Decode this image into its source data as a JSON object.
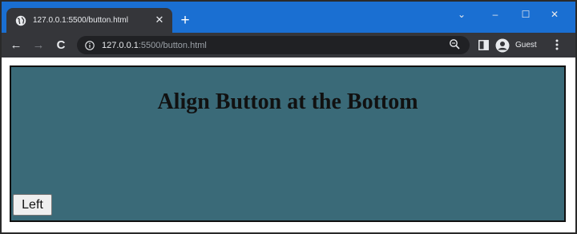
{
  "browser": {
    "tab": {
      "title": "127.0.0.1:5500/button.html",
      "close_glyph": "✕",
      "favicon": "globe-icon"
    },
    "new_tab_glyph": "+",
    "window_controls": {
      "dropdown": "⌄",
      "minimize": "–",
      "maximize": "☐",
      "close": "✕"
    },
    "nav": {
      "back": "←",
      "forward": "→",
      "reload": "C"
    },
    "address": {
      "host": "127.0.0.1",
      "rest": ":5500/button.html"
    },
    "profile_label": "Guest"
  },
  "page": {
    "heading": "Align Button at the Bottom",
    "button_label": "Left"
  },
  "colors": {
    "titlebar": "#1a6fd2",
    "toolbar": "#35363a",
    "container_bg": "#3a6a78",
    "container_border": "#101010"
  }
}
